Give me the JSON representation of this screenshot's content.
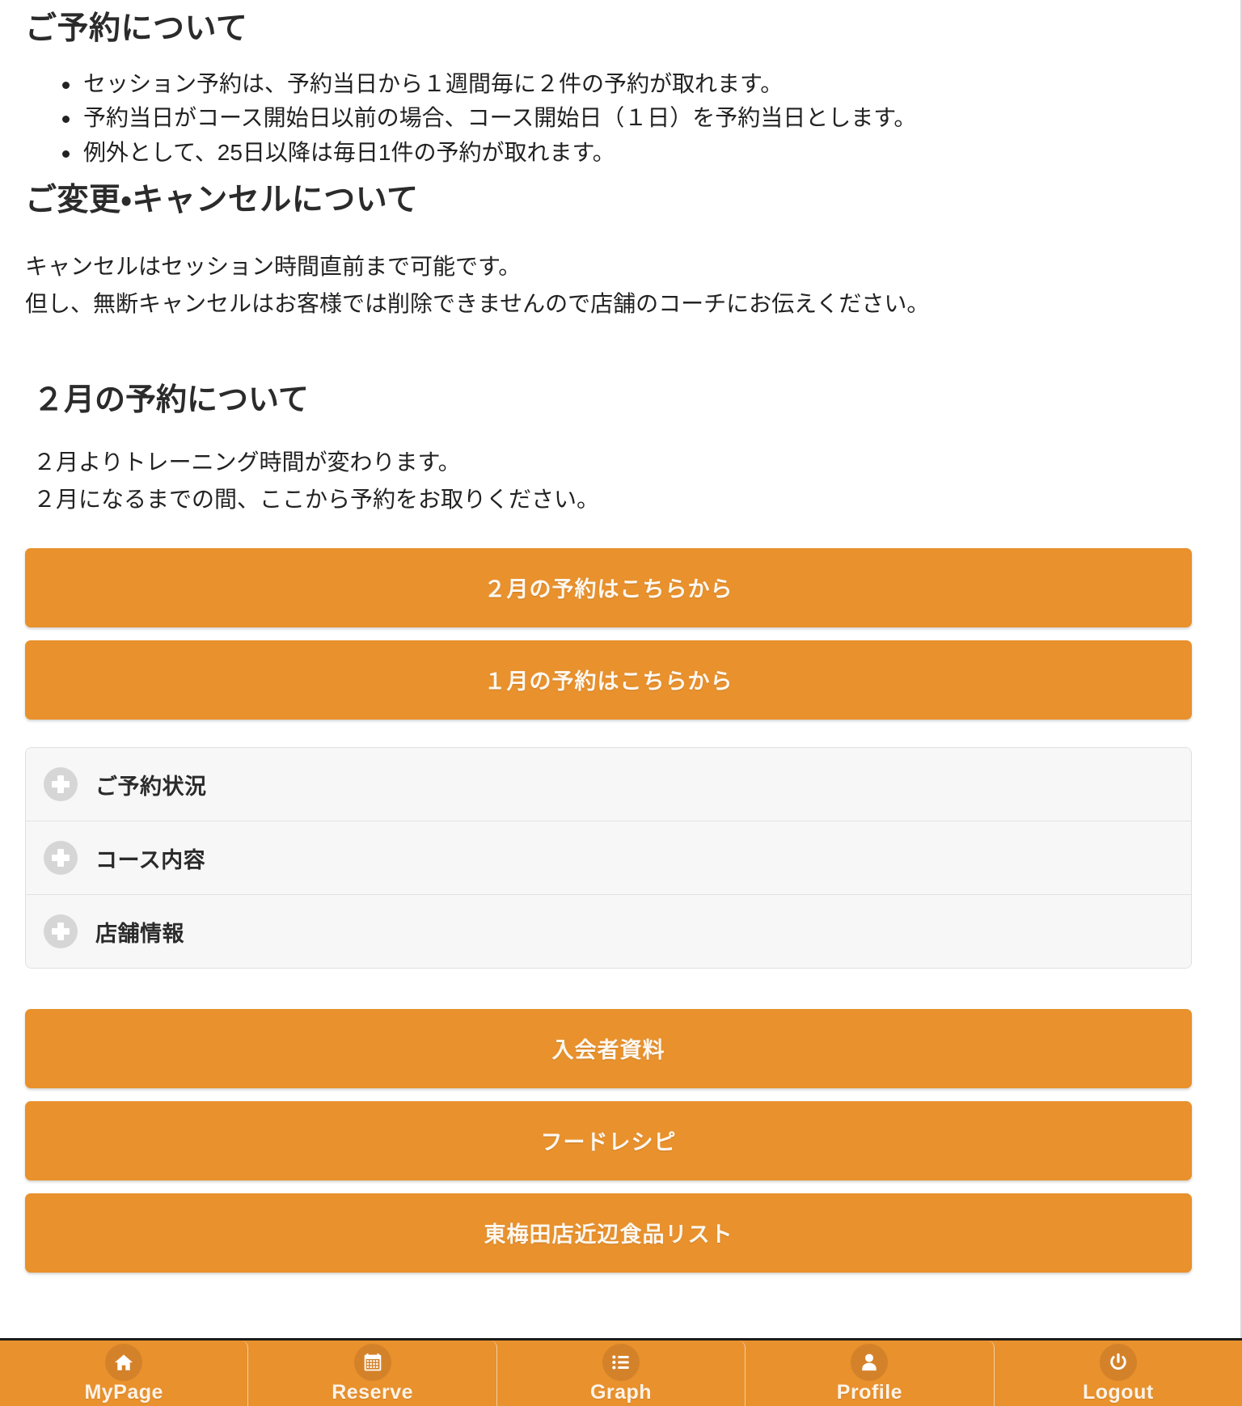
{
  "reservation_section": {
    "heading": "ご予約について",
    "bullets": [
      "セッション予約は、予約当日から１週間毎に２件の予約が取れます。",
      "予約当日がコース開始日以前の場合、コース開始日（１日）を予約当日とします。",
      "例外として、25日以降は毎日1件の予約が取れます。"
    ]
  },
  "change_section": {
    "heading": "ご変更・キャンセルについて",
    "line1": "キャンセルはセッション時間直前まで可能です。",
    "line2": "但し、無断キャンセルはお客様では削除できませんので店舗のコーチにお伝えください。"
  },
  "february_section": {
    "heading": "２月の予約について",
    "line1": "２月よりトレーニング時間が変わります。",
    "line2": "２月になるまでの間、ここから予約をお取りください。"
  },
  "month_buttons": [
    {
      "label": "２月の予約はこちらから",
      "name": "february-reservation-button"
    },
    {
      "label": "１月の予約はこちらから",
      "name": "january-reservation-button"
    }
  ],
  "accordion": {
    "items": [
      {
        "label": "ご予約状況",
        "icon": "plus-icon",
        "name": "accordion-reservation-status"
      },
      {
        "label": "コース内容",
        "icon": "plus-icon",
        "name": "accordion-course-content"
      },
      {
        "label": "店舗情報",
        "icon": "plus-icon",
        "name": "accordion-store-info"
      }
    ]
  },
  "document_buttons": [
    {
      "label": "入会者資料",
      "name": "member-materials-button"
    },
    {
      "label": "フードレシピ",
      "name": "food-recipe-button"
    },
    {
      "label": "東梅田店近辺食品リスト",
      "name": "higashi-umeda-food-list-button"
    }
  ],
  "bottom_nav": {
    "items": [
      {
        "label": "MyPage",
        "icon": "home-icon"
      },
      {
        "label": "Reserve",
        "icon": "calendar-icon"
      },
      {
        "label": "Graph",
        "icon": "list-icon"
      },
      {
        "label": "Profile",
        "icon": "person-icon"
      },
      {
        "label": "Logout",
        "icon": "power-icon"
      }
    ]
  },
  "colors": {
    "accent_orange": "#e8912d",
    "icon_circle_orange": "#d4822a",
    "accordion_bg": "#f7f7f7",
    "plus_gray": "#d6d6d6",
    "text_dark": "#222222",
    "button_text": "#fdf7ef"
  }
}
